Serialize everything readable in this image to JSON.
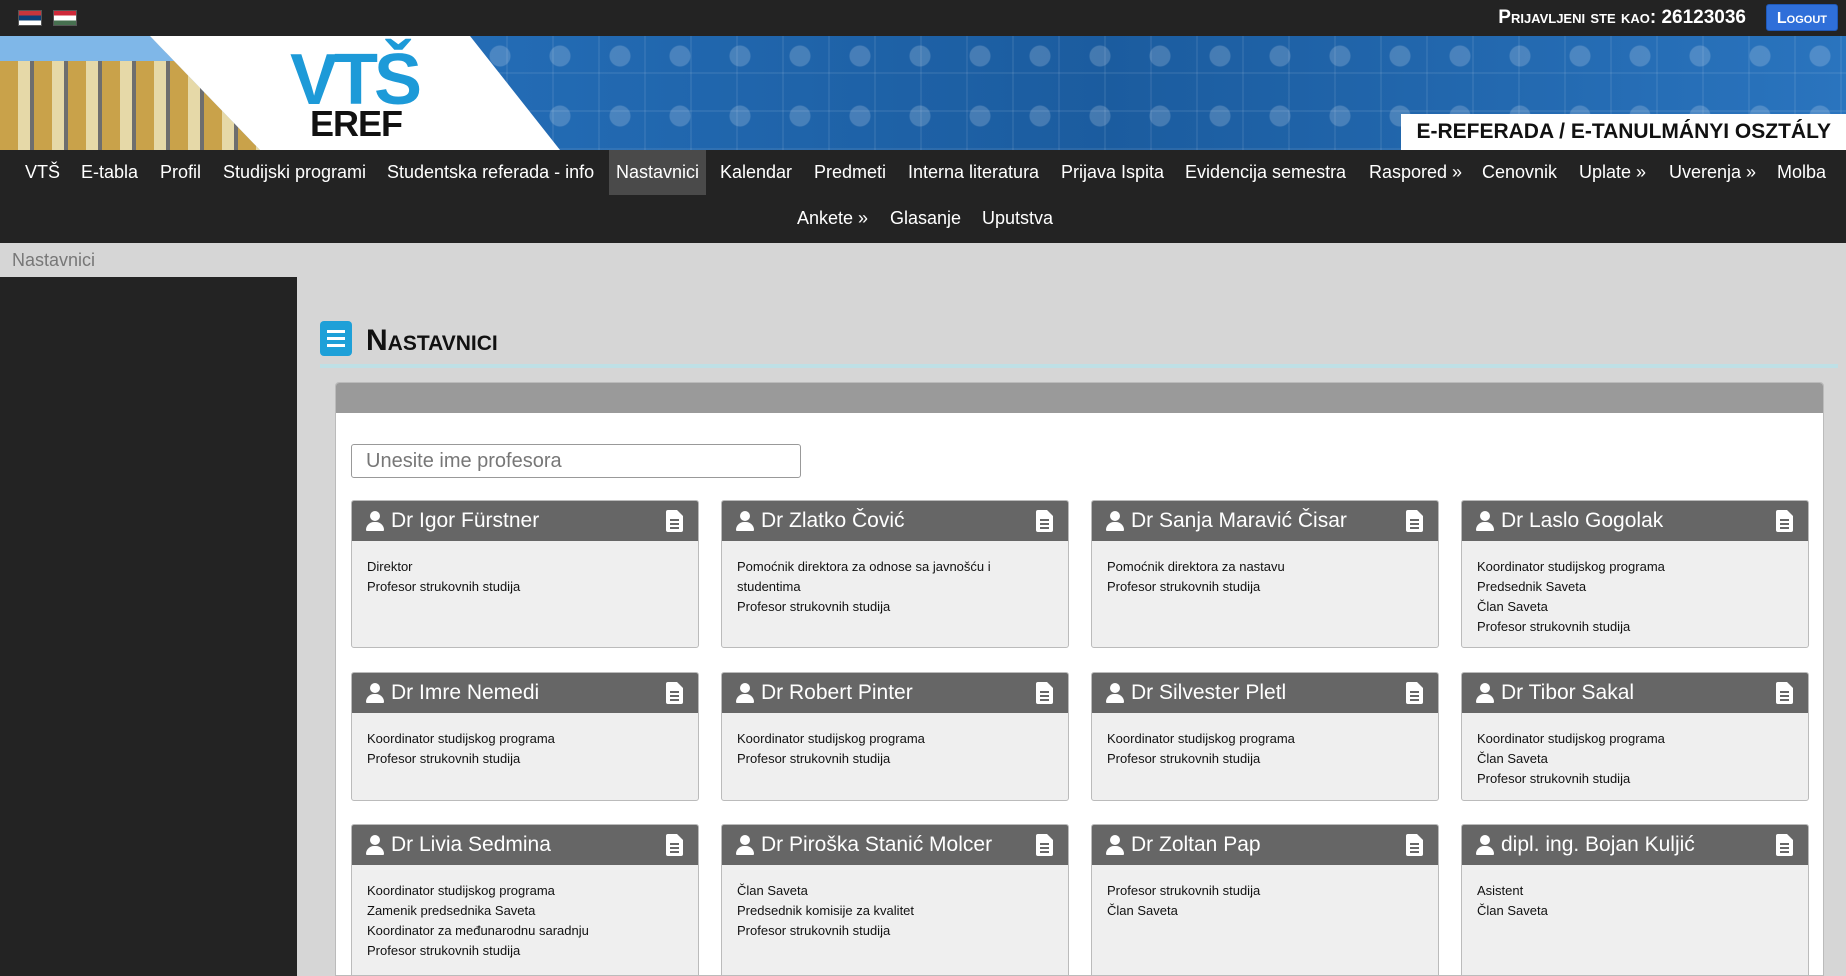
{
  "topbar": {
    "flags": [
      "serbian-flag",
      "hungarian-flag"
    ],
    "login_label": "Prijavljeni ste kao:",
    "user_id": "26123036",
    "logout_label": "Logout"
  },
  "banner": {
    "logo_top": "VTŠ",
    "logo_bottom": "EREF",
    "label": "E-REFERADA / E-TANULMÁNYI OSZTÁLY"
  },
  "nav": {
    "items": [
      {
        "label": "VTŠ"
      },
      {
        "label": "E-tabla"
      },
      {
        "label": "Profil"
      },
      {
        "label": "Studijski programi"
      },
      {
        "label": "Studentska referada - info"
      },
      {
        "label": "Nastavnici",
        "active": true
      },
      {
        "label": "Kalendar"
      },
      {
        "label": "Predmeti"
      },
      {
        "label": "Interna literatura"
      },
      {
        "label": "Prijava Ispita"
      },
      {
        "label": "Evidencija semestra"
      },
      {
        "label": "Raspored »"
      },
      {
        "label": "Cenovnik"
      },
      {
        "label": "Uplate »"
      },
      {
        "label": "Uverenja »"
      },
      {
        "label": "Molba"
      },
      {
        "label": "Ankete »"
      },
      {
        "label": "Glasanje"
      },
      {
        "label": "Uputstva"
      }
    ]
  },
  "breadcrumb": "Nastavnici",
  "page": {
    "title": "Nastavnici",
    "search_placeholder": "Unesite ime profesora"
  },
  "teachers": [
    {
      "name": "Dr Igor Fürstner",
      "roles": [
        "Direktor",
        "Profesor strukovnih studija"
      ]
    },
    {
      "name": "Dr Zlatko Čović",
      "roles": [
        "Pomoćnik direktora za odnose sa javnošću i studentima",
        "Profesor strukovnih studija"
      ]
    },
    {
      "name": "Dr Sanja Maravić Čisar",
      "roles": [
        "Pomoćnik direktora za nastavu",
        "Profesor strukovnih studija"
      ]
    },
    {
      "name": "Dr Laslo Gogolak",
      "roles": [
        "Koordinator studijskog programa",
        "Predsednik Saveta",
        "Član Saveta",
        "Profesor strukovnih studija"
      ]
    },
    {
      "name": "Dr Imre Nemedi",
      "roles": [
        "Koordinator studijskog programa",
        "Profesor strukovnih studija"
      ]
    },
    {
      "name": "Dr Robert Pinter",
      "roles": [
        "Koordinator studijskog programa",
        "Profesor strukovnih studija"
      ]
    },
    {
      "name": "Dr Silvester Pletl",
      "roles": [
        "Koordinator studijskog programa",
        "Profesor strukovnih studija"
      ]
    },
    {
      "name": "Dr Tibor Sakal",
      "roles": [
        "Koordinator studijskog programa",
        "Član Saveta",
        "Profesor strukovnih studija"
      ]
    },
    {
      "name": "Dr Livia Sedmina",
      "roles": [
        "Koordinator studijskog programa",
        "Zamenik predsednika Saveta",
        "Koordinator za međunarodnu saradnju",
        "Profesor strukovnih studija"
      ]
    },
    {
      "name": "Dr Piroška Stanić Molcer",
      "roles": [
        "Član Saveta",
        "Predsednik komisije za kvalitet",
        "Profesor strukovnih studija"
      ]
    },
    {
      "name": "Dr Zoltan Pap",
      "roles": [
        "Profesor strukovnih studija",
        "Član Saveta"
      ]
    },
    {
      "name": "dipl. ing. Bojan Kuljić",
      "roles": [
        "Asistent",
        "Član Saveta"
      ]
    }
  ]
}
